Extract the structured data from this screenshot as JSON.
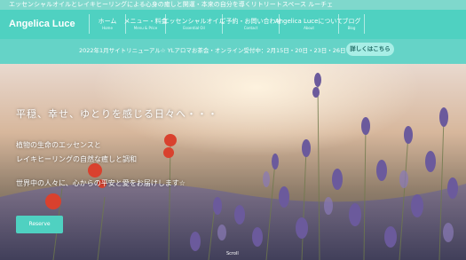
{
  "topbar": {
    "text": "エッセンシャルオイルとレイキヒーリングによる心身の癒しと開運・本来の自分を導くリトリートスペース ルーチェ"
  },
  "header": {
    "logo": "Angelica Luce",
    "nav": [
      {
        "label": "ホーム",
        "sub": "Home"
      },
      {
        "label": "メニュー・料金",
        "sub": "Menu & Price"
      },
      {
        "label": "エッセンシャルオイル",
        "sub": "Essential Oil"
      },
      {
        "label": "ご予約・お問い合わせ",
        "sub": "Contact"
      },
      {
        "label": "Angelica Luceについて",
        "sub": "About"
      },
      {
        "label": "ブログ",
        "sub": "Blog"
      }
    ]
  },
  "notice": {
    "text": "2022年1月サイトリニューアル☆ YLアロマお茶会・オンライン受付中：2月15日・20日・23日・26日",
    "button": "詳しくはこちら"
  },
  "hero": {
    "title": "平穏、幸せ、ゆとりを感じる日々へ・・・",
    "lines": [
      "植物の生命のエッセンスと",
      "レイキヒーリングの自然な癒しと調和",
      "世界中の人々に、心からの平安と愛をお届けします☆"
    ],
    "button": "Reserve",
    "scroll": "Scroll"
  },
  "colors": {
    "accent": "#4fd1c1",
    "topbar": "#7fd8cc",
    "notice": "#65d3c7"
  }
}
